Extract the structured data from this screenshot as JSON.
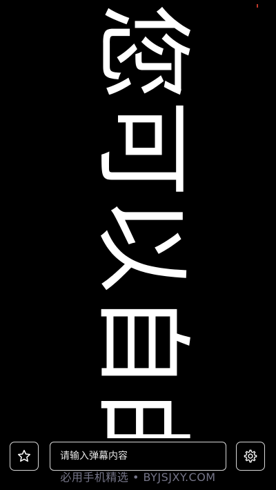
{
  "danmaku": {
    "text": "您可以自由"
  },
  "input": {
    "placeholder": "请输入弹幕内容",
    "value": ""
  },
  "icons": {
    "favorite": "star-icon",
    "settings": "gear-icon"
  },
  "watermark": {
    "text": "必用手机精选 • BYJSJXY.COM"
  },
  "colors": {
    "background": "#000000",
    "text": "#ffffff",
    "border": "#d9d9d9",
    "status_dot": "#c0392b"
  }
}
